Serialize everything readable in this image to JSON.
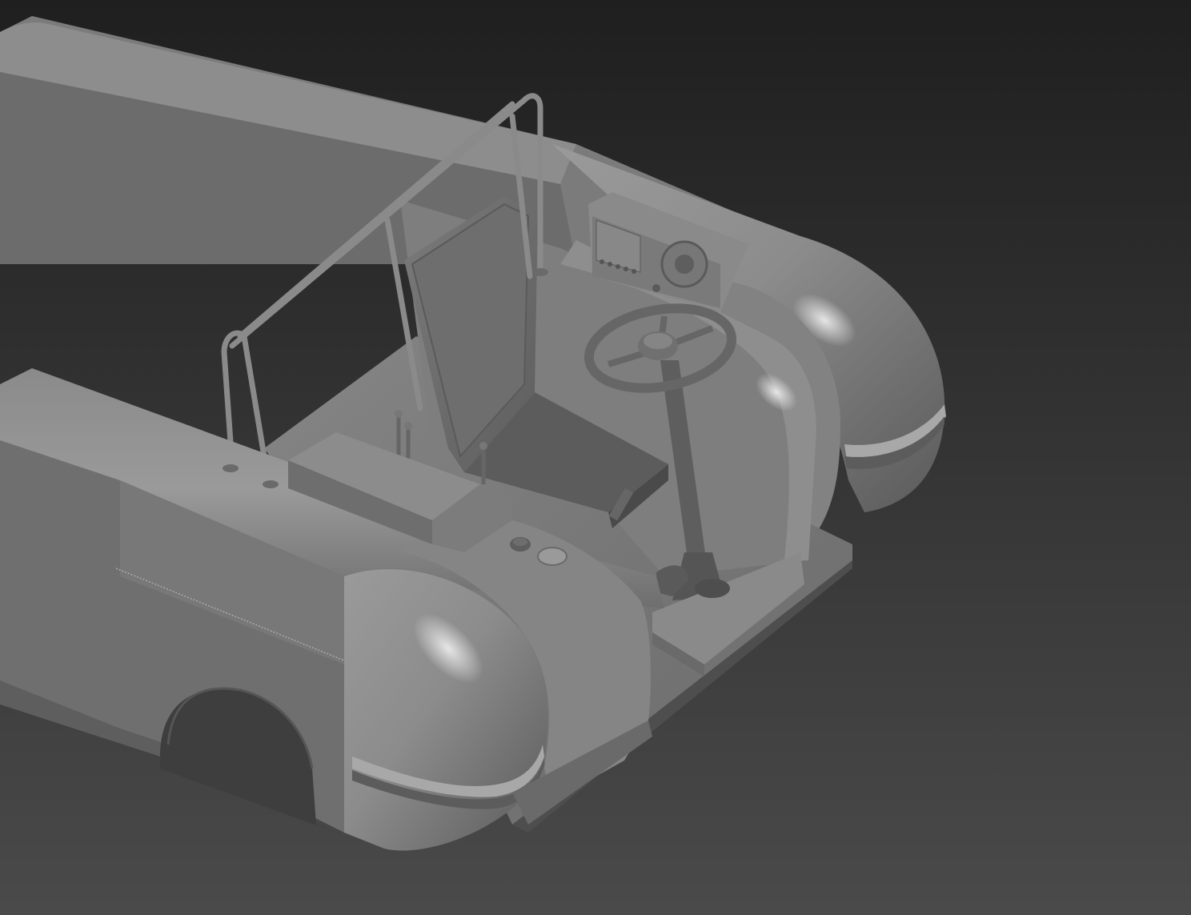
{
  "viewport": {
    "background_top": "#1f1f1f",
    "background_bottom": "#4a4a4a",
    "model_base_color": "#8f8f8f",
    "model_shadow_color": "#5e5e5e",
    "model_highlight_color": "#c8c8c8"
  },
  "model": {
    "dash_buttons": 5
  }
}
